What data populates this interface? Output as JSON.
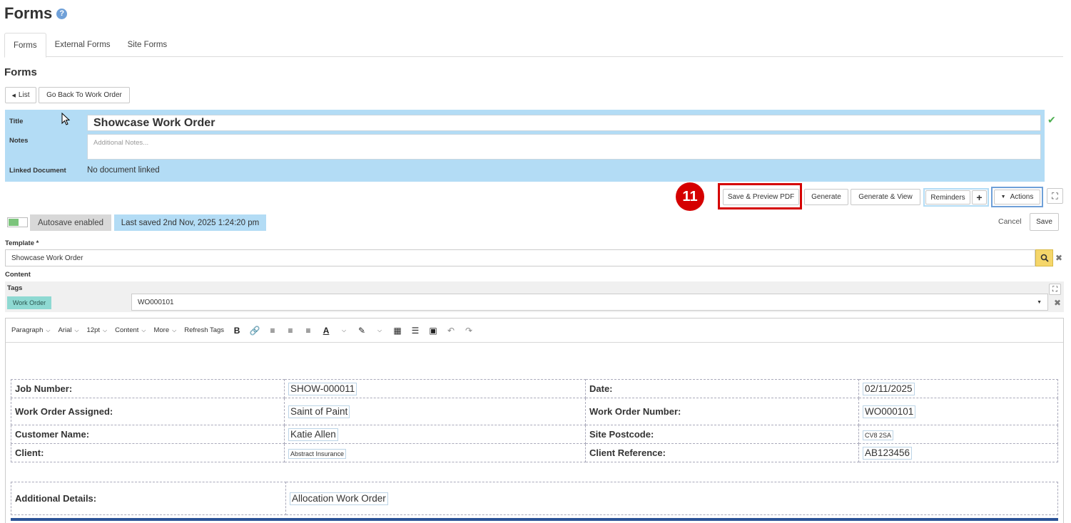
{
  "page": {
    "title": "Forms",
    "help_icon": "?"
  },
  "tabs": [
    {
      "label": "Forms",
      "active": true
    },
    {
      "label": "External Forms",
      "active": false
    },
    {
      "label": "Site Forms",
      "active": false
    }
  ],
  "section": {
    "title": "Forms"
  },
  "nav": {
    "list_label": "List",
    "go_back_label": "Go Back To Work Order"
  },
  "form": {
    "title_label": "Title",
    "title_value": "Showcase Work Order",
    "notes_label": "Notes",
    "notes_placeholder": "Additional Notes...",
    "linked_label": "Linked Document",
    "linked_value": "No document linked"
  },
  "annotation": {
    "step_number": "11"
  },
  "actions": {
    "save_preview": "Save & Preview PDF",
    "generate": "Generate",
    "generate_view": "Generate & View",
    "reminders": "Reminders",
    "plus": "+",
    "actions": "Actions"
  },
  "status": {
    "autosave": "Autosave enabled",
    "last_saved": "Last saved 2nd Nov, 2025 1:24:20 pm",
    "cancel": "Cancel",
    "save": "Save"
  },
  "template": {
    "label": "Template *",
    "value": "Showcase Work Order"
  },
  "content": {
    "label": "Content"
  },
  "tags": {
    "label": "Tags",
    "chip": "Work Order",
    "selected": "WO000101"
  },
  "toolbar": {
    "paragraph": "Paragraph",
    "font": "Arial",
    "size": "12pt",
    "content": "Content",
    "more": "More",
    "refresh_tags": "Refresh Tags"
  },
  "document": {
    "rows": [
      {
        "l1": "Job Number:",
        "v1": "SHOW-000011",
        "l2": "Date:",
        "v2": "02/11/2025"
      },
      {
        "l1": "Work Order Assigned:",
        "v1": "Saint of Paint",
        "l2": "Work Order Number:",
        "v2": "WO000101"
      },
      {
        "l1": "Customer Name:",
        "v1": "Katie Allen",
        "l2": "Site Postcode:",
        "v2": "CV8 2SA"
      },
      {
        "l1": "Client:",
        "v1": "Abstract Insurance",
        "l2": "Client Reference:",
        "v2": "AB123456"
      }
    ],
    "additional_label": "Additional Details:",
    "additional_value": "Allocation Work Order"
  },
  "colors": {
    "panel_blue": "#b3dcf5",
    "highlight_red": "#d50000",
    "accent_blue": "#6fa0d8",
    "tag_teal": "#8ed9d2"
  }
}
